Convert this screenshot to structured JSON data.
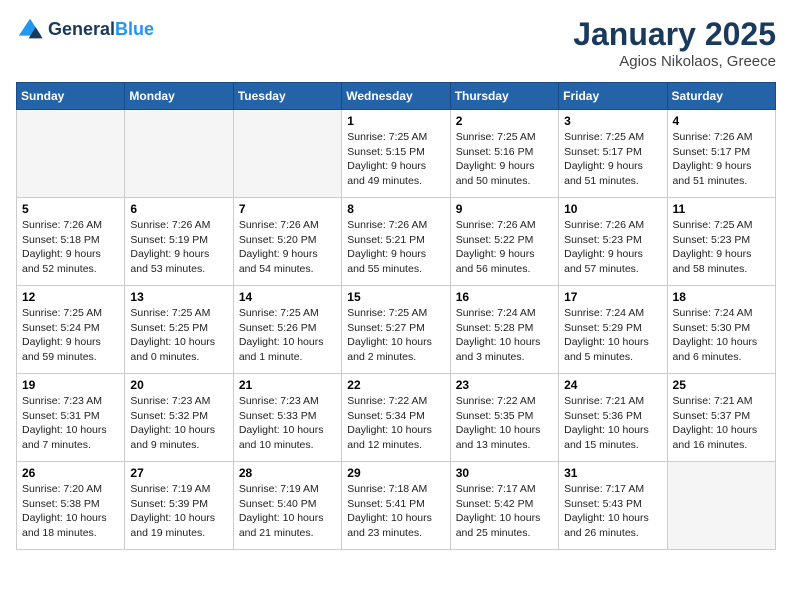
{
  "header": {
    "logo_line1": "General",
    "logo_line2": "Blue",
    "title": "January 2025",
    "subtitle": "Agios Nikolaos, Greece"
  },
  "days_of_week": [
    "Sunday",
    "Monday",
    "Tuesday",
    "Wednesday",
    "Thursday",
    "Friday",
    "Saturday"
  ],
  "weeks": [
    [
      {
        "day": "",
        "detail": ""
      },
      {
        "day": "",
        "detail": ""
      },
      {
        "day": "",
        "detail": ""
      },
      {
        "day": "1",
        "detail": "Sunrise: 7:25 AM\nSunset: 5:15 PM\nDaylight: 9 hours\nand 49 minutes."
      },
      {
        "day": "2",
        "detail": "Sunrise: 7:25 AM\nSunset: 5:16 PM\nDaylight: 9 hours\nand 50 minutes."
      },
      {
        "day": "3",
        "detail": "Sunrise: 7:25 AM\nSunset: 5:17 PM\nDaylight: 9 hours\nand 51 minutes."
      },
      {
        "day": "4",
        "detail": "Sunrise: 7:26 AM\nSunset: 5:17 PM\nDaylight: 9 hours\nand 51 minutes."
      }
    ],
    [
      {
        "day": "5",
        "detail": "Sunrise: 7:26 AM\nSunset: 5:18 PM\nDaylight: 9 hours\nand 52 minutes."
      },
      {
        "day": "6",
        "detail": "Sunrise: 7:26 AM\nSunset: 5:19 PM\nDaylight: 9 hours\nand 53 minutes."
      },
      {
        "day": "7",
        "detail": "Sunrise: 7:26 AM\nSunset: 5:20 PM\nDaylight: 9 hours\nand 54 minutes."
      },
      {
        "day": "8",
        "detail": "Sunrise: 7:26 AM\nSunset: 5:21 PM\nDaylight: 9 hours\nand 55 minutes."
      },
      {
        "day": "9",
        "detail": "Sunrise: 7:26 AM\nSunset: 5:22 PM\nDaylight: 9 hours\nand 56 minutes."
      },
      {
        "day": "10",
        "detail": "Sunrise: 7:26 AM\nSunset: 5:23 PM\nDaylight: 9 hours\nand 57 minutes."
      },
      {
        "day": "11",
        "detail": "Sunrise: 7:25 AM\nSunset: 5:23 PM\nDaylight: 9 hours\nand 58 minutes."
      }
    ],
    [
      {
        "day": "12",
        "detail": "Sunrise: 7:25 AM\nSunset: 5:24 PM\nDaylight: 9 hours\nand 59 minutes."
      },
      {
        "day": "13",
        "detail": "Sunrise: 7:25 AM\nSunset: 5:25 PM\nDaylight: 10 hours\nand 0 minutes."
      },
      {
        "day": "14",
        "detail": "Sunrise: 7:25 AM\nSunset: 5:26 PM\nDaylight: 10 hours\nand 1 minute."
      },
      {
        "day": "15",
        "detail": "Sunrise: 7:25 AM\nSunset: 5:27 PM\nDaylight: 10 hours\nand 2 minutes."
      },
      {
        "day": "16",
        "detail": "Sunrise: 7:24 AM\nSunset: 5:28 PM\nDaylight: 10 hours\nand 3 minutes."
      },
      {
        "day": "17",
        "detail": "Sunrise: 7:24 AM\nSunset: 5:29 PM\nDaylight: 10 hours\nand 5 minutes."
      },
      {
        "day": "18",
        "detail": "Sunrise: 7:24 AM\nSunset: 5:30 PM\nDaylight: 10 hours\nand 6 minutes."
      }
    ],
    [
      {
        "day": "19",
        "detail": "Sunrise: 7:23 AM\nSunset: 5:31 PM\nDaylight: 10 hours\nand 7 minutes."
      },
      {
        "day": "20",
        "detail": "Sunrise: 7:23 AM\nSunset: 5:32 PM\nDaylight: 10 hours\nand 9 minutes."
      },
      {
        "day": "21",
        "detail": "Sunrise: 7:23 AM\nSunset: 5:33 PM\nDaylight: 10 hours\nand 10 minutes."
      },
      {
        "day": "22",
        "detail": "Sunrise: 7:22 AM\nSunset: 5:34 PM\nDaylight: 10 hours\nand 12 minutes."
      },
      {
        "day": "23",
        "detail": "Sunrise: 7:22 AM\nSunset: 5:35 PM\nDaylight: 10 hours\nand 13 minutes."
      },
      {
        "day": "24",
        "detail": "Sunrise: 7:21 AM\nSunset: 5:36 PM\nDaylight: 10 hours\nand 15 minutes."
      },
      {
        "day": "25",
        "detail": "Sunrise: 7:21 AM\nSunset: 5:37 PM\nDaylight: 10 hours\nand 16 minutes."
      }
    ],
    [
      {
        "day": "26",
        "detail": "Sunrise: 7:20 AM\nSunset: 5:38 PM\nDaylight: 10 hours\nand 18 minutes."
      },
      {
        "day": "27",
        "detail": "Sunrise: 7:19 AM\nSunset: 5:39 PM\nDaylight: 10 hours\nand 19 minutes."
      },
      {
        "day": "28",
        "detail": "Sunrise: 7:19 AM\nSunset: 5:40 PM\nDaylight: 10 hours\nand 21 minutes."
      },
      {
        "day": "29",
        "detail": "Sunrise: 7:18 AM\nSunset: 5:41 PM\nDaylight: 10 hours\nand 23 minutes."
      },
      {
        "day": "30",
        "detail": "Sunrise: 7:17 AM\nSunset: 5:42 PM\nDaylight: 10 hours\nand 25 minutes."
      },
      {
        "day": "31",
        "detail": "Sunrise: 7:17 AM\nSunset: 5:43 PM\nDaylight: 10 hours\nand 26 minutes."
      },
      {
        "day": "",
        "detail": ""
      }
    ]
  ]
}
